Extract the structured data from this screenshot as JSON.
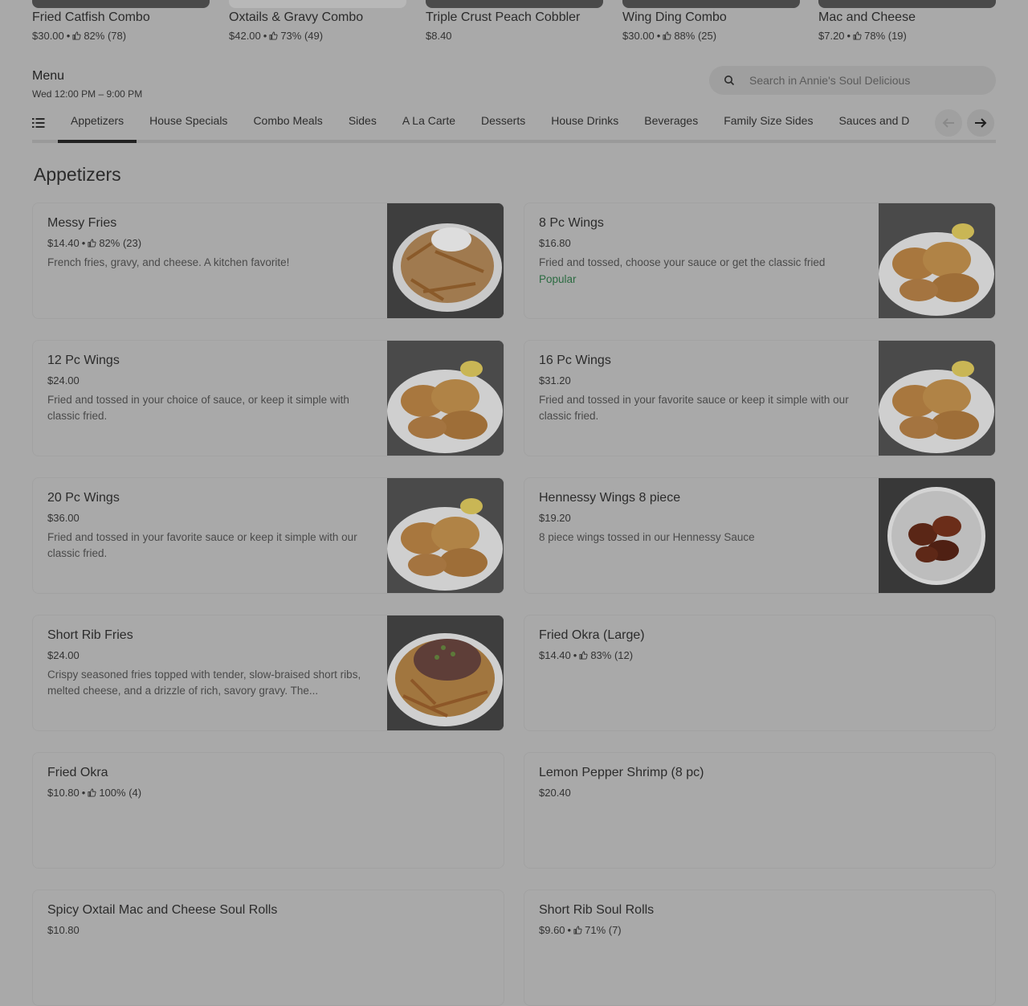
{
  "featured": [
    {
      "name": "Fried Catfish Combo",
      "price": "$30.00",
      "rating": "82% (78)"
    },
    {
      "name": "Oxtails & Gravy Combo",
      "price": "$42.00",
      "rating": "73% (49)"
    },
    {
      "name": "Triple Crust Peach Cobbler",
      "price": "$8.40",
      "rating": ""
    },
    {
      "name": "Wing Ding Combo",
      "price": "$30.00",
      "rating": "88% (25)"
    },
    {
      "name": "Mac and Cheese",
      "price": "$7.20",
      "rating": "78% (19)"
    }
  ],
  "menu": {
    "title": "Menu",
    "hours": "Wed 12:00 PM – 9:00 PM"
  },
  "search": {
    "placeholder": "Search in Annie's Soul Delicious"
  },
  "tabs": [
    "Appetizers",
    "House Specials",
    "Combo Meals",
    "Sides",
    "A La Carte",
    "Desserts",
    "House Drinks",
    "Beverages",
    "Family Size Sides",
    "Sauces and D"
  ],
  "section": {
    "title": "Appetizers"
  },
  "items": [
    {
      "name": "Messy Fries",
      "price": "$14.40",
      "rating": "82% (23)",
      "desc": "French fries, gravy, and cheese. A kitchen favorite!",
      "badge": "",
      "photo": "fries"
    },
    {
      "name": "8 Pc Wings",
      "price": "$16.80",
      "rating": "",
      "desc": "Fried and tossed, choose your sauce or get the classic fried",
      "badge": "Popular",
      "photo": "wings"
    },
    {
      "name": "12 Pc Wings",
      "price": "$24.00",
      "rating": "",
      "desc": "Fried and tossed in your choice of sauce, or keep it simple with classic fried.",
      "badge": "",
      "photo": "wings"
    },
    {
      "name": "16 Pc Wings",
      "price": "$31.20",
      "rating": "",
      "desc": "Fried and tossed in your favorite sauce or keep it simple with our classic fried.",
      "badge": "",
      "photo": "wings"
    },
    {
      "name": "20 Pc Wings",
      "price": "$36.00",
      "rating": "",
      "desc": "Fried and tossed in your favorite sauce or keep it simple with our classic fried.",
      "badge": "",
      "photo": "wings"
    },
    {
      "name": "Hennessy Wings 8 piece",
      "price": "$19.20",
      "rating": "",
      "desc": "8 piece wings tossed in our Hennessy Sauce",
      "badge": "",
      "photo": "hennessy"
    },
    {
      "name": "Short Rib Fries",
      "price": "$24.00",
      "rating": "",
      "desc": "Crispy seasoned fries topped with tender, slow-braised short ribs, melted cheese, and a drizzle of rich, savory gravy. The...",
      "badge": "",
      "photo": "shortrib"
    },
    {
      "name": "Fried Okra (Large)",
      "price": "$14.40",
      "rating": "83% (12)",
      "desc": "",
      "badge": "",
      "photo": ""
    },
    {
      "name": "Fried Okra",
      "price": "$10.80",
      "rating": "100% (4)",
      "desc": "",
      "badge": "",
      "photo": ""
    },
    {
      "name": "Lemon Pepper Shrimp (8 pc)",
      "price": "$20.40",
      "rating": "",
      "desc": "",
      "badge": "",
      "photo": ""
    },
    {
      "name": "Spicy Oxtail Mac and Cheese Soul Rolls",
      "price": "$10.80",
      "rating": "",
      "desc": "",
      "badge": "",
      "photo": ""
    },
    {
      "name": "Short Rib Soul Rolls",
      "price": "$9.60",
      "rating": "71% (7)",
      "desc": "",
      "badge": "",
      "photo": ""
    }
  ],
  "icons": {
    "search": "search-icon",
    "list": "list-icon",
    "prev": "arrow-left-icon",
    "next": "arrow-right-icon",
    "thumbs_up": "thumbs-up-icon"
  }
}
